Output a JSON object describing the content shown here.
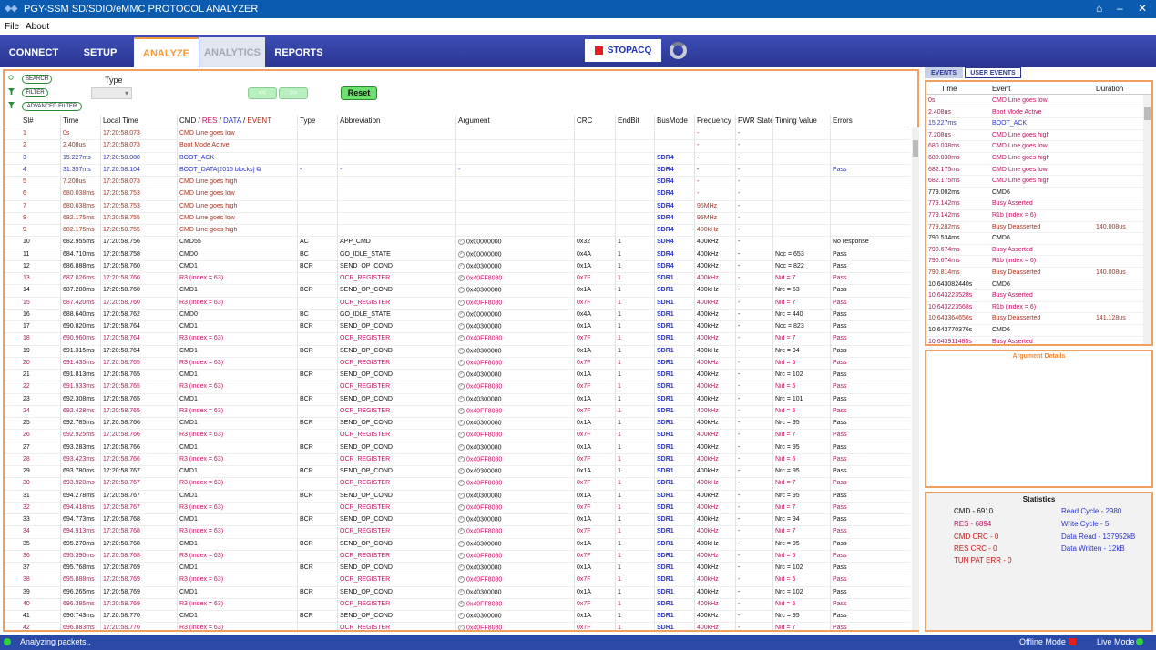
{
  "app": {
    "title": "PGY-SSM SD/SDIO/eMMC PROTOCOL ANALYZER"
  },
  "menu": {
    "file": "File",
    "about": "About"
  },
  "nav": {
    "tabs": [
      "CONNECT",
      "SETUP",
      "ANALYZE",
      "ANALYTICS",
      "REPORTS"
    ],
    "active": "ANALYZE",
    "stop_label": "STOPACQ"
  },
  "filters": {
    "search": "SEARCH",
    "filter": "FILTER",
    "advanced": "ADVANCED FILTER",
    "type_label": "Type",
    "type_value": "",
    "prev": "<<",
    "next": ">>",
    "reset": "Reset"
  },
  "table": {
    "columns": [
      "Sl#",
      "Time",
      "Local Time",
      "CMD / RES / DATA / EVENT",
      "Type",
      "Abbreviation",
      "Argument",
      "CRC",
      "EndBit",
      "BusMode",
      "Frequency",
      "PWR State",
      "Timing Value",
      "Errors"
    ],
    "cmd_header": {
      "cmd": "CMD",
      "res": "RES",
      "data": "DATA",
      "event": "EVENT"
    },
    "rows": [
      {
        "k": "e",
        "v": [
          "1",
          "0s",
          "17:20:58.073",
          "CMD Line goes low",
          "",
          "",
          "",
          "",
          "",
          "",
          "-",
          "-",
          "",
          ""
        ]
      },
      {
        "k": "e",
        "v": [
          "2",
          "2.408us",
          "17:20:58.073",
          "Boot Mode Active",
          "",
          "",
          "",
          "",
          "",
          "",
          "-",
          "-",
          "",
          ""
        ]
      },
      {
        "k": "d",
        "v": [
          "3",
          "15.227ms",
          "17:20:58.088",
          "BOOT_ACK",
          "",
          "",
          "",
          "",
          "",
          "SDR4",
          "-",
          "-",
          "",
          ""
        ]
      },
      {
        "k": "d",
        "v": [
          "4",
          "31.357ms",
          "17:20:58.104",
          "BOOT_DATA[2015 blocks]",
          "-",
          "-",
          "-",
          "",
          "",
          "SDR4",
          "-",
          "-",
          "",
          "Pass"
        ]
      },
      {
        "k": "e",
        "v": [
          "5",
          "7.208us",
          "17:20:58.073",
          "CMD Line goes high",
          "",
          "",
          "",
          "",
          "",
          "SDR4",
          "-",
          "-",
          "",
          ""
        ]
      },
      {
        "k": "e",
        "v": [
          "6",
          "680.038ms",
          "17:20:58.753",
          "CMD Line goes low",
          "",
          "",
          "",
          "",
          "",
          "SDR4",
          "-",
          "-",
          "",
          ""
        ]
      },
      {
        "k": "e",
        "v": [
          "7",
          "680.038ms",
          "17:20:58.753",
          "CMD Line goes high",
          "",
          "",
          "",
          "",
          "",
          "SDR4",
          "95MHz",
          "-",
          "",
          ""
        ]
      },
      {
        "k": "e",
        "v": [
          "8",
          "682.175ms",
          "17:20:58.755",
          "CMD Line goes low",
          "",
          "",
          "",
          "",
          "",
          "SDR4",
          "95MHz",
          "-",
          "",
          ""
        ]
      },
      {
        "k": "e",
        "v": [
          "9",
          "682.175ms",
          "17:20:58.755",
          "CMD Line goes high",
          "",
          "",
          "",
          "",
          "",
          "SDR4",
          "400kHz",
          "-",
          "",
          ""
        ]
      },
      {
        "k": "c",
        "v": [
          "10",
          "682.955ms",
          "17:20:58.756",
          "CMD55",
          "AC",
          "APP_CMD",
          "0x00000000",
          "0x32",
          "1",
          "SDR4",
          "400kHz",
          "-",
          "",
          "No response"
        ]
      },
      {
        "k": "c",
        "v": [
          "11",
          "684.710ms",
          "17:20:58.758",
          "CMD0",
          "BC",
          "GO_IDLE_STATE",
          "0x00000000",
          "0x4A",
          "1",
          "SDR4",
          "400kHz",
          "-",
          "Ncc = 653",
          "Pass"
        ]
      },
      {
        "k": "c",
        "v": [
          "12",
          "686.888ms",
          "17:20:58.760",
          "CMD1",
          "BCR",
          "SEND_OP_COND",
          "0x40300080",
          "0x1A",
          "1",
          "SDR4",
          "400kHz",
          "-",
          "Ncc = 822",
          "Pass"
        ]
      },
      {
        "k": "r",
        "v": [
          "13",
          "687.026ms",
          "17:20:58.760",
          "R3 (index = 63)",
          "",
          "OCR_REGISTER",
          "0x40FF8080",
          "0x7F",
          "1",
          "SDR1",
          "400kHz",
          "-",
          "Nid = 7",
          "Pass"
        ]
      },
      {
        "k": "c",
        "v": [
          "14",
          "687.280ms",
          "17:20:58.760",
          "CMD1",
          "BCR",
          "SEND_OP_COND",
          "0x40300080",
          "0x1A",
          "1",
          "SDR1",
          "400kHz",
          "-",
          "Nrc = 53",
          "Pass"
        ]
      },
      {
        "k": "r",
        "v": [
          "15",
          "687.420ms",
          "17:20:58.760",
          "R3 (index = 63)",
          "",
          "OCR_REGISTER",
          "0x40FF8080",
          "0x7F",
          "1",
          "SDR1",
          "400kHz",
          "-",
          "Nid = 7",
          "Pass"
        ]
      },
      {
        "k": "c",
        "v": [
          "16",
          "688.640ms",
          "17:20:58.762",
          "CMD0",
          "BC",
          "GO_IDLE_STATE",
          "0x00000000",
          "0x4A",
          "1",
          "SDR1",
          "400kHz",
          "-",
          "Nrc = 440",
          "Pass"
        ]
      },
      {
        "k": "c",
        "v": [
          "17",
          "690.820ms",
          "17:20:58.764",
          "CMD1",
          "BCR",
          "SEND_OP_COND",
          "0x40300080",
          "0x1A",
          "1",
          "SDR1",
          "400kHz",
          "-",
          "Ncc = 823",
          "Pass"
        ]
      },
      {
        "k": "r",
        "v": [
          "18",
          "690.960ms",
          "17:20:58.764",
          "R3 (index = 63)",
          "",
          "OCR_REGISTER",
          "0x40FF8080",
          "0x7F",
          "1",
          "SDR1",
          "400kHz",
          "-",
          "Nid = 7",
          "Pass"
        ]
      },
      {
        "k": "c",
        "v": [
          "19",
          "691.315ms",
          "17:20:58.764",
          "CMD1",
          "BCR",
          "SEND_OP_COND",
          "0x40300080",
          "0x1A",
          "1",
          "SDR1",
          "400kHz",
          "-",
          "Nrc = 94",
          "Pass"
        ]
      },
      {
        "k": "r",
        "v": [
          "20",
          "691.435ms",
          "17:20:58.765",
          "R3 (index = 63)",
          "",
          "OCR_REGISTER",
          "0x40FF8080",
          "0x7F",
          "1",
          "SDR1",
          "400kHz",
          "-",
          "Nid = 5",
          "Pass"
        ]
      },
      {
        "k": "c",
        "v": [
          "21",
          "691.813ms",
          "17:20:58.765",
          "CMD1",
          "BCR",
          "SEND_OP_COND",
          "0x40300080",
          "0x1A",
          "1",
          "SDR1",
          "400kHz",
          "-",
          "Nrc = 102",
          "Pass"
        ]
      },
      {
        "k": "r",
        "v": [
          "22",
          "691.933ms",
          "17:20:58.765",
          "R3 (index = 63)",
          "",
          "OCR_REGISTER",
          "0x40FF8080",
          "0x7F",
          "1",
          "SDR1",
          "400kHz",
          "-",
          "Nid = 5",
          "Pass"
        ]
      },
      {
        "k": "c",
        "v": [
          "23",
          "692.308ms",
          "17:20:58.765",
          "CMD1",
          "BCR",
          "SEND_OP_COND",
          "0x40300080",
          "0x1A",
          "1",
          "SDR1",
          "400kHz",
          "-",
          "Nrc = 101",
          "Pass"
        ]
      },
      {
        "k": "r",
        "v": [
          "24",
          "692.428ms",
          "17:20:58.765",
          "R3 (index = 63)",
          "",
          "OCR_REGISTER",
          "0x40FF8080",
          "0x7F",
          "1",
          "SDR1",
          "400kHz",
          "-",
          "Nid = 5",
          "Pass"
        ]
      },
      {
        "k": "c",
        "v": [
          "25",
          "692.785ms",
          "17:20:58.766",
          "CMD1",
          "BCR",
          "SEND_OP_COND",
          "0x40300080",
          "0x1A",
          "1",
          "SDR1",
          "400kHz",
          "-",
          "Nrc = 95",
          "Pass"
        ]
      },
      {
        "k": "r",
        "v": [
          "26",
          "692.925ms",
          "17:20:58.766",
          "R3 (index = 63)",
          "",
          "OCR_REGISTER",
          "0x40FF8080",
          "0x7F",
          "1",
          "SDR1",
          "400kHz",
          "-",
          "Nid = 7",
          "Pass"
        ]
      },
      {
        "k": "c",
        "v": [
          "27",
          "693.283ms",
          "17:20:58.766",
          "CMD1",
          "BCR",
          "SEND_OP_COND",
          "0x40300080",
          "0x1A",
          "1",
          "SDR1",
          "400kHz",
          "-",
          "Nrc = 95",
          "Pass"
        ]
      },
      {
        "k": "r",
        "v": [
          "28",
          "693.423ms",
          "17:20:58.766",
          "R3 (index = 63)",
          "",
          "OCR_REGISTER",
          "0x40FF8080",
          "0x7F",
          "1",
          "SDR1",
          "400kHz",
          "-",
          "Nid = 6",
          "Pass"
        ]
      },
      {
        "k": "c",
        "v": [
          "29",
          "693.780ms",
          "17:20:58.767",
          "CMD1",
          "BCR",
          "SEND_OP_COND",
          "0x40300080",
          "0x1A",
          "1",
          "SDR1",
          "400kHz",
          "-",
          "Nrc = 95",
          "Pass"
        ]
      },
      {
        "k": "r",
        "v": [
          "30",
          "693.920ms",
          "17:20:58.767",
          "R3 (index = 63)",
          "",
          "OCR_REGISTER",
          "0x40FF8080",
          "0x7F",
          "1",
          "SDR1",
          "400kHz",
          "-",
          "Nid = 7",
          "Pass"
        ]
      },
      {
        "k": "c",
        "v": [
          "31",
          "694.278ms",
          "17:20:58.767",
          "CMD1",
          "BCR",
          "SEND_OP_COND",
          "0x40300080",
          "0x1A",
          "1",
          "SDR1",
          "400kHz",
          "-",
          "Nrc = 95",
          "Pass"
        ]
      },
      {
        "k": "r",
        "v": [
          "32",
          "694.418ms",
          "17:20:58.767",
          "R3 (index = 63)",
          "",
          "OCR_REGISTER",
          "0x40FF8080",
          "0x7F",
          "1",
          "SDR1",
          "400kHz",
          "-",
          "Nid = 7",
          "Pass"
        ]
      },
      {
        "k": "c",
        "v": [
          "33",
          "694.773ms",
          "17:20:58.768",
          "CMD1",
          "BCR",
          "SEND_OP_COND",
          "0x40300080",
          "0x1A",
          "1",
          "SDR1",
          "400kHz",
          "-",
          "Nrc = 94",
          "Pass"
        ]
      },
      {
        "k": "r",
        "v": [
          "34",
          "694.913ms",
          "17:20:58.768",
          "R3 (index = 63)",
          "",
          "OCR_REGISTER",
          "0x40FF8080",
          "0x7F",
          "1",
          "SDR1",
          "400kHz",
          "-",
          "Nid = 7",
          "Pass"
        ]
      },
      {
        "k": "c",
        "v": [
          "35",
          "695.270ms",
          "17:20:58.768",
          "CMD1",
          "BCR",
          "SEND_OP_COND",
          "0x40300080",
          "0x1A",
          "1",
          "SDR1",
          "400kHz",
          "-",
          "Nrc = 95",
          "Pass"
        ]
      },
      {
        "k": "r",
        "v": [
          "36",
          "695.390ms",
          "17:20:58.768",
          "R3 (index = 63)",
          "",
          "OCR_REGISTER",
          "0x40FF8080",
          "0x7F",
          "1",
          "SDR1",
          "400kHz",
          "-",
          "Nid = 5",
          "Pass"
        ]
      },
      {
        "k": "c",
        "v": [
          "37",
          "695.768ms",
          "17:20:58.769",
          "CMD1",
          "BCR",
          "SEND_OP_COND",
          "0x40300080",
          "0x1A",
          "1",
          "SDR1",
          "400kHz",
          "-",
          "Nrc = 102",
          "Pass"
        ]
      },
      {
        "k": "r",
        "v": [
          "38",
          "695.888ms",
          "17:20:58.769",
          "R3 (index = 63)",
          "",
          "OCR_REGISTER",
          "0x40FF8080",
          "0x7F",
          "1",
          "SDR1",
          "400kHz",
          "-",
          "Nid = 5",
          "Pass"
        ]
      },
      {
        "k": "c",
        "v": [
          "39",
          "696.265ms",
          "17:20:58.769",
          "CMD1",
          "BCR",
          "SEND_OP_COND",
          "0x40300080",
          "0x1A",
          "1",
          "SDR1",
          "400kHz",
          "-",
          "Nrc = 102",
          "Pass"
        ]
      },
      {
        "k": "r",
        "v": [
          "40",
          "696.385ms",
          "17:20:58.769",
          "R3 (index = 63)",
          "",
          "OCR_REGISTER",
          "0x40FF8080",
          "0x7F",
          "1",
          "SDR1",
          "400kHz",
          "-",
          "Nid = 5",
          "Pass"
        ]
      },
      {
        "k": "c",
        "v": [
          "41",
          "696.743ms",
          "17:20:58.770",
          "CMD1",
          "BCR",
          "SEND_OP_COND",
          "0x40300080",
          "0x1A",
          "1",
          "SDR1",
          "400kHz",
          "-",
          "Nrc = 95",
          "Pass"
        ]
      },
      {
        "k": "r",
        "v": [
          "42",
          "696.883ms",
          "17:20:58.770",
          "R3 (index = 63)",
          "",
          "OCR_REGISTER",
          "0x40FF8080",
          "0x7F",
          "1",
          "SDR1",
          "400kHz",
          "-",
          "Nid = 7",
          "Pass"
        ]
      }
    ]
  },
  "events": {
    "tabs": [
      "EVENTS",
      "USER EVENTS"
    ],
    "columns": [
      "Time",
      "Event",
      "Duration"
    ],
    "rows": [
      {
        "k": "r",
        "v": [
          "0s",
          "CMD Line goes low",
          ""
        ]
      },
      {
        "k": "r",
        "v": [
          "2.408us",
          "Boot Mode Active",
          ""
        ]
      },
      {
        "k": "d",
        "v": [
          "15.227ms",
          "BOOT_ACK",
          ""
        ]
      },
      {
        "k": "r",
        "v": [
          "7.208us",
          "CMD Line goes high",
          ""
        ]
      },
      {
        "k": "r",
        "v": [
          "680.038ms",
          "CMD Line goes low",
          ""
        ]
      },
      {
        "k": "r",
        "v": [
          "680.038ms",
          "CMD Line goes high",
          ""
        ]
      },
      {
        "k": "r",
        "v": [
          "682.175ms",
          "CMD Line goes low",
          ""
        ]
      },
      {
        "k": "r",
        "v": [
          "682.175ms",
          "CMD Line goes high",
          ""
        ]
      },
      {
        "k": "c",
        "v": [
          "779.002ms",
          "CMD6",
          ""
        ]
      },
      {
        "k": "r",
        "v": [
          "779.142ms",
          "Busy Asserted",
          ""
        ]
      },
      {
        "k": "r",
        "v": [
          "779.142ms",
          "R1b (index = 6)",
          ""
        ]
      },
      {
        "k": "e",
        "v": [
          "779.282ms",
          "Busy Deasserted",
          "140.008us"
        ]
      },
      {
        "k": "c",
        "v": [
          "790.534ms",
          "CMD6",
          ""
        ]
      },
      {
        "k": "r",
        "v": [
          "790.674ms",
          "Busy Asserted",
          ""
        ]
      },
      {
        "k": "r",
        "v": [
          "790.674ms",
          "R1b (index = 6)",
          ""
        ]
      },
      {
        "k": "e",
        "v": [
          "790.814ms",
          "Busy Deasserted",
          "140.008us"
        ]
      },
      {
        "k": "c",
        "v": [
          "10.643082440s",
          "CMD6",
          ""
        ]
      },
      {
        "k": "r",
        "v": [
          "10.643223528s",
          "Busy Asserted",
          ""
        ]
      },
      {
        "k": "r",
        "v": [
          "10.643223568s",
          "R1b (index = 6)",
          ""
        ]
      },
      {
        "k": "e",
        "v": [
          "10.643364656s",
          "Busy Deasserted",
          "141.128us"
        ]
      },
      {
        "k": "c",
        "v": [
          "10.643770376s",
          "CMD6",
          ""
        ]
      },
      {
        "k": "r",
        "v": [
          "10.643911480s",
          "Busy Asserted",
          ""
        ]
      }
    ]
  },
  "argument": {
    "title": "Argument Details"
  },
  "statistics": {
    "title": "Statistics",
    "cmd": "CMD - 6910",
    "res": "RES - 6894",
    "cmd_crc": "CMD CRC - 0",
    "res_crc": "RES CRC - 0",
    "tun": "TUN PAT ERR - 0",
    "read_cycle": "Read Cycle - 2980",
    "write_cycle": "Write Cycle - 5",
    "data_read": "Data Read - 137952kB",
    "data_written": "Data Written - 12kB"
  },
  "status": {
    "message": "Analyzing packets..",
    "offline": "Offline Mode",
    "live": "Live Mode"
  },
  "colors": {
    "accent": "#f29a3a",
    "nav": "#2a3591",
    "cmd_text": "#111111",
    "res_text": "#c01060",
    "event_text": "#b0301a",
    "data_text": "#2a35c8"
  }
}
